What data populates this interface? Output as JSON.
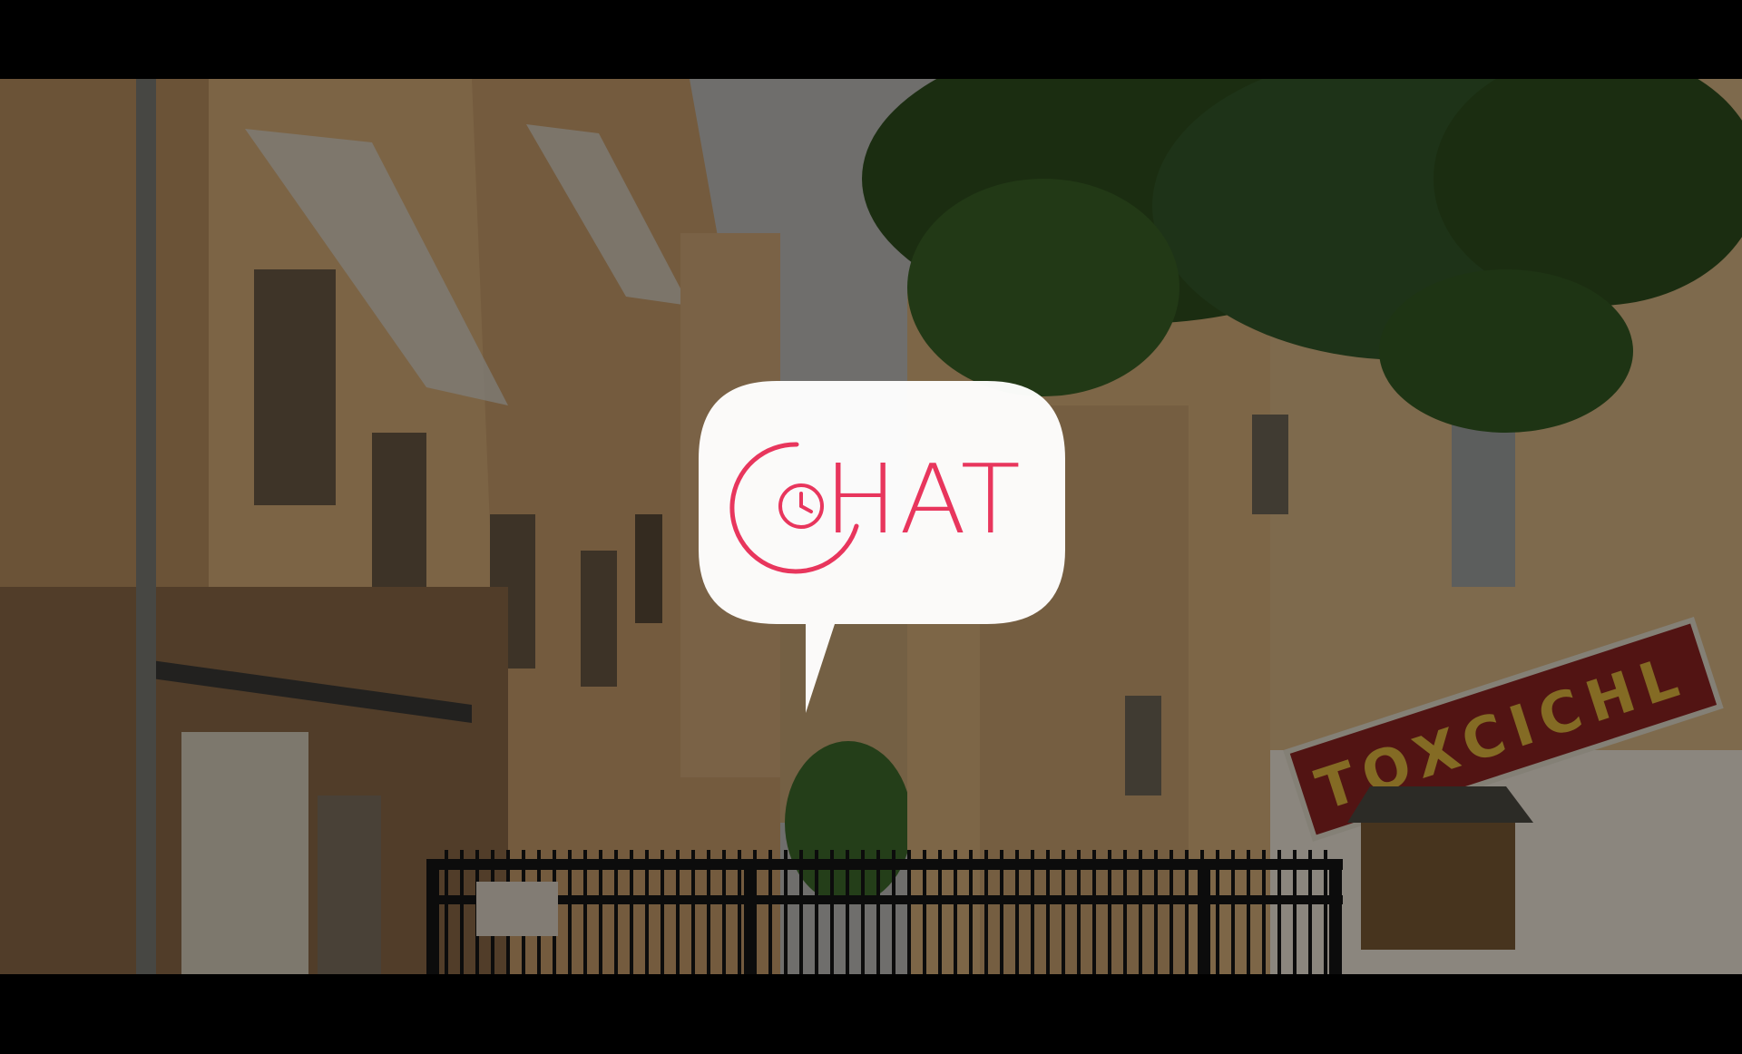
{
  "logo": {
    "word": "HAT",
    "clock_icon": "clock-icon",
    "accent": "#e8365d",
    "bubble_color": "#ffffff"
  },
  "shop_sign": {
    "text": "TOXCICHL",
    "color": "#e3b93f",
    "background": "#8e2421"
  },
  "scene": {
    "overlay_color": "#000000",
    "sky_color": "#a7a7a4"
  }
}
